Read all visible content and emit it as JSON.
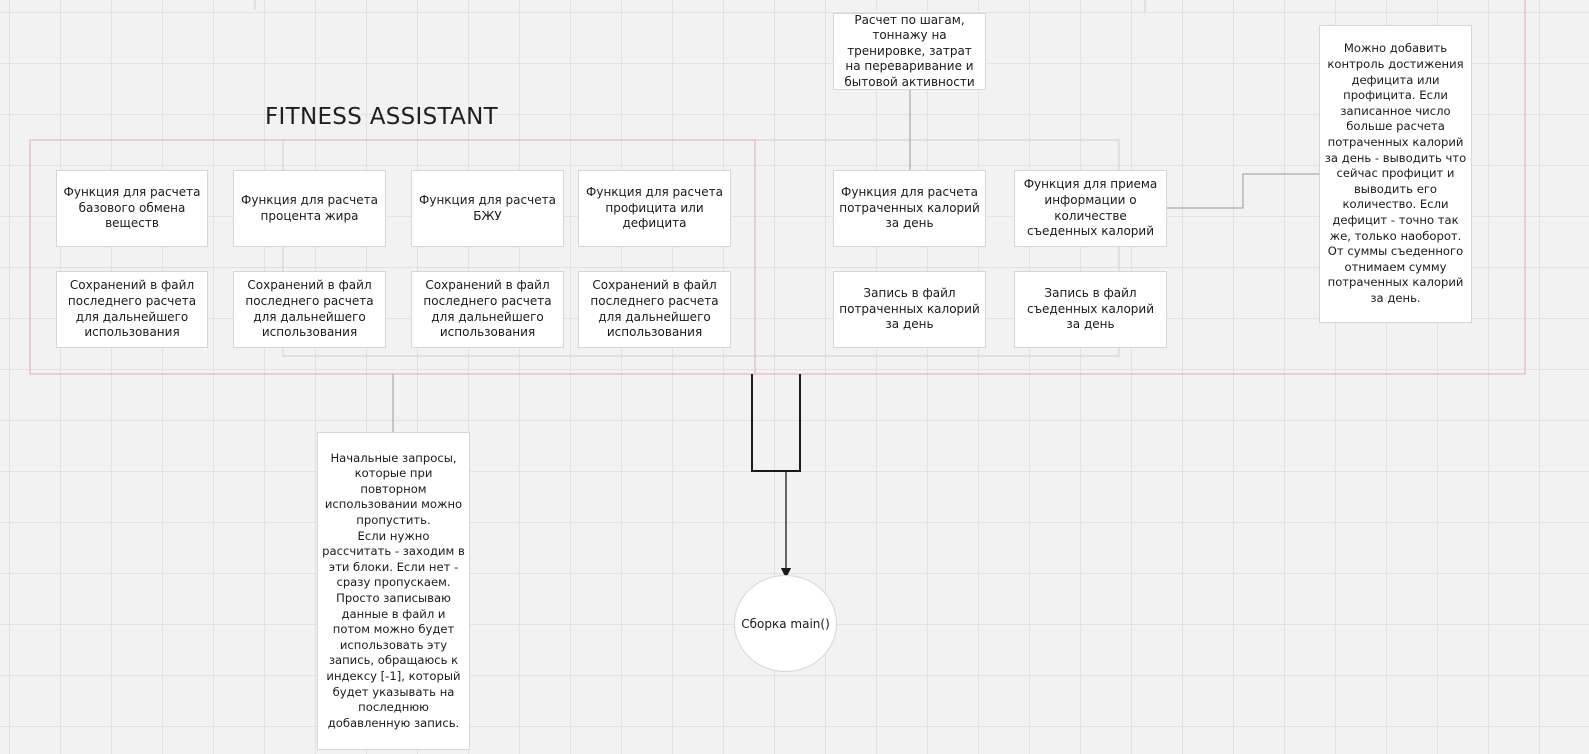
{
  "title": "FITNESS ASSISTANT",
  "functions": {
    "bmr": "Функция для расчета базового обмена веществ",
    "fat_percent": "Функция для расчета процента жира",
    "bju": "Функция для расчета БЖУ",
    "surplus_deficit": "Функция для расчета профицита или дефицита",
    "calories_spent": "Функция для расчета потраченных калорий за день",
    "calories_eaten": "Функция для приема информации о количестве съеденных калорий"
  },
  "saves": {
    "bmr": "Сохранений в файл последнего расчета для дальнейшего использования",
    "fat_percent": "Сохранений в файл последнего расчета для дальнейшего использования",
    "bju": "Сохранений в файл последнего расчета для дальнейшего использования",
    "surplus_deficit": "Сохранений в файл последнего расчета для дальнейшего использования",
    "calories_spent": "Запись в файл потраченных калорий за день",
    "calories_eaten": "Запись в файл съеденных калорий за день"
  },
  "notes": {
    "steps": "Расчет по шагам, тоннажу на тренировке, затрат на переваривание и бытовой активности",
    "control": "Можно добавить контроль достижения дефицита или профицита. Если записанное число больше расчета потраченных калорий за день - выводить что сейчас профицит и выводить его количество. Если дефицит - точно так же, только наоборот.\nОт суммы съеденного отнимаем сумму потраченных калорий за день.",
    "initial": "Начальные запросы, которые при повторном использовании можно пропустить.\nЕсли нужно рассчитать - заходим в эти блоки. Если нет - сразу пропускаем.\nПросто записываю данные в файл и потом можно будет использовать эту запись, обращаюсь к индексу [-1], который будет указывать на последнюю добавленную запись."
  },
  "main": "Сборка main()",
  "colors": {
    "group_border": "#e6a8b2",
    "connector": "#1a1a1a",
    "thin_connector": "#9a9a9a",
    "node_border": "#d6d6d6"
  }
}
